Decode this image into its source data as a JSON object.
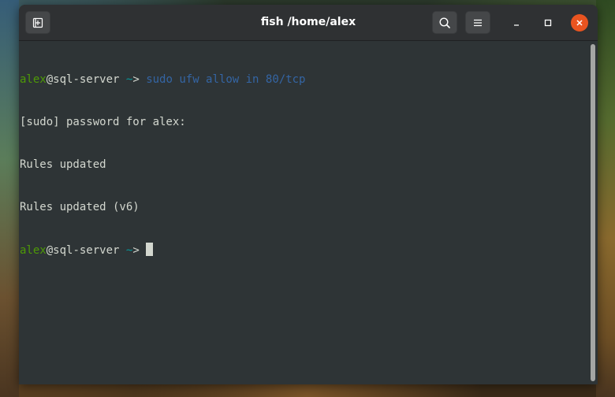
{
  "window": {
    "title": "fish /home/alex"
  },
  "terminal": {
    "lines": [
      {
        "prompt": {
          "user": "alex",
          "at": "@",
          "host": "sql-server",
          "space": " ",
          "cwd": "~",
          "arrow": "> "
        },
        "command": "sudo ufw allow in 80/tcp"
      },
      {
        "text": "[sudo] password for alex:"
      },
      {
        "text": "Rules updated"
      },
      {
        "text": "Rules updated (v6)"
      },
      {
        "prompt": {
          "user": "alex",
          "at": "@",
          "host": "sql-server",
          "space": " ",
          "cwd": "~",
          "arrow": "> "
        },
        "command": ""
      }
    ]
  },
  "icons": {
    "new_tab": "new-tab-icon",
    "search": "search-icon",
    "menu": "hamburger-menu-icon",
    "minimize": "minimize-icon",
    "maximize": "maximize-icon",
    "close": "close-icon"
  },
  "colors": {
    "prompt_user": "#4e9a06",
    "prompt_cwd": "#06989a",
    "command": "#3465a4",
    "output": "#d3d7cf",
    "background": "#2e3436",
    "close_button": "#e95420"
  }
}
